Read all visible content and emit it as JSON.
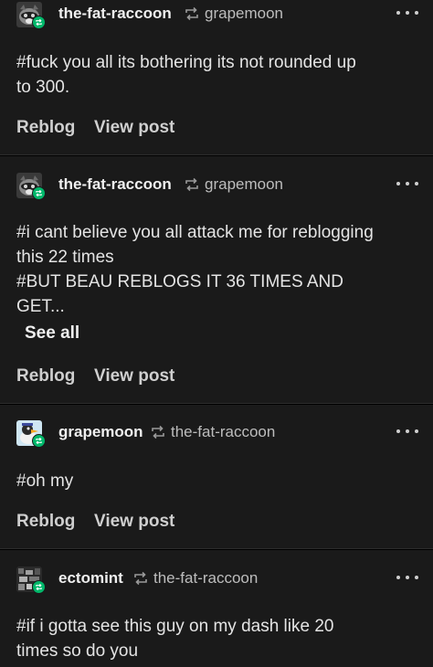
{
  "posts": [
    {
      "author": "the-fat-raccoon",
      "source": "grapemoon",
      "avatar_icon": "raccoon-avatar-icon",
      "tags": [
        "#fuck you all its bothering its not rounded up",
        "to 300."
      ],
      "reblog_label": "Reblog",
      "view_label": "View post"
    },
    {
      "author": "the-fat-raccoon",
      "source": "grapemoon",
      "avatar_icon": "raccoon-avatar-icon",
      "tags": [
        "#i cant believe you all attack me for reblogging",
        "this 22 times",
        "#BUT BEAU REBLOGS IT 36 TIMES AND",
        "GET..."
      ],
      "see_all_label": "See all",
      "reblog_label": "Reblog",
      "view_label": "View post"
    },
    {
      "author": "grapemoon",
      "source": "the-fat-raccoon",
      "avatar_icon": "duck-avatar-icon",
      "tags": [
        "#oh my"
      ],
      "reblog_label": "Reblog",
      "view_label": "View post"
    },
    {
      "author": "ectomint",
      "source": "the-fat-raccoon",
      "avatar_icon": "pixel-avatar-icon",
      "tags": [
        "#if i gotta see this guy on my dash like 20",
        "times so do you"
      ]
    }
  ],
  "colors": {
    "background": "#1a1a1a",
    "divider": "#2c2c2c",
    "badge": "#00b86b",
    "author_text": "#f0f0f0",
    "source_text": "#bdbdbd",
    "action_text": "#cfcfcf"
  }
}
